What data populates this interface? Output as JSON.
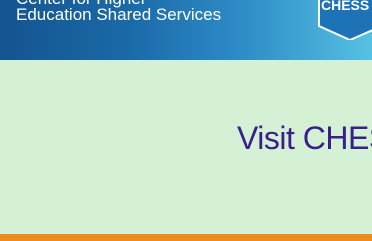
{
  "header": {
    "line_top": "Center for Higher",
    "line_bottom": "Education Shared Services",
    "logo_text": "CHESS"
  },
  "main": {
    "visit_label": "Visit CHESS"
  },
  "colors": {
    "banner_start": "#14548f",
    "banner_end": "#56c1e2",
    "background": "#d4f1d6",
    "link_text": "#3a1e8c",
    "footer_bar": "#ef8a1e",
    "logo_fill": "#1d73b5"
  }
}
